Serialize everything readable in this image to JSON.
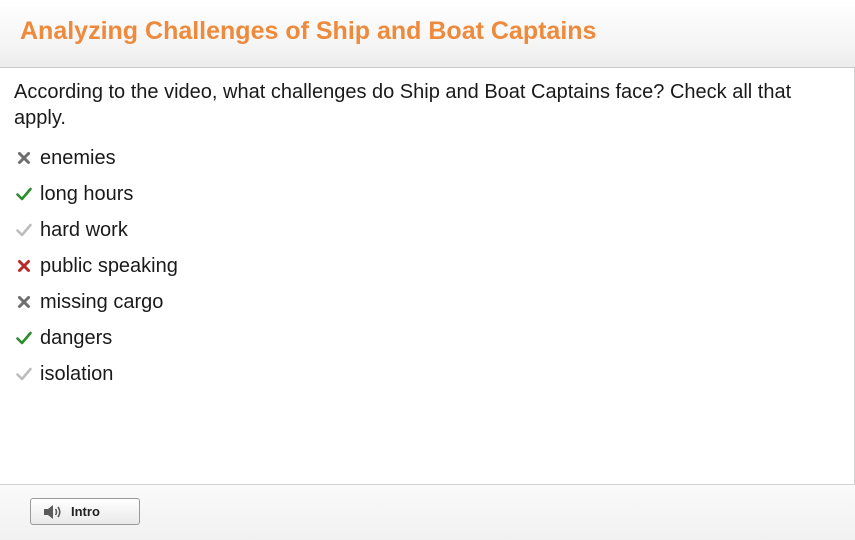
{
  "header": {
    "title": "Analyzing Challenges of Ship and Boat Captains"
  },
  "question": {
    "text": "According to the video, what challenges do Ship and Boat Captains face? Check all that apply."
  },
  "options": [
    {
      "label": "enemies",
      "mark": "x-icon",
      "state": "not-selected"
    },
    {
      "label": "long hours",
      "mark": "check-icon",
      "state": "correct"
    },
    {
      "label": "hard work",
      "mark": "check-icon",
      "state": "missed"
    },
    {
      "label": "public speaking",
      "mark": "x-icon",
      "state": "incorrect"
    },
    {
      "label": "missing cargo",
      "mark": "x-icon",
      "state": "not-selected"
    },
    {
      "label": "dangers",
      "mark": "check-icon",
      "state": "correct"
    },
    {
      "label": "isolation",
      "mark": "check-icon",
      "state": "missed"
    }
  ],
  "colors": {
    "title": "#ee8a3c",
    "correct": "#2e8b2e",
    "incorrect": "#b82a2a",
    "not_selected": "#6e6e6e",
    "missed": "#bdbdbd"
  },
  "footer": {
    "intro_label": "Intro",
    "intro_icon": "speaker-icon"
  }
}
